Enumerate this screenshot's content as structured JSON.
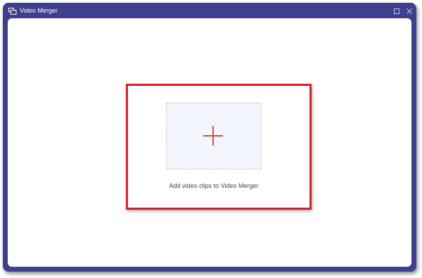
{
  "window": {
    "title": "Video Merger",
    "app_icon": "merge-windows-icon",
    "controls": [
      "maximize-icon",
      "close-icon"
    ]
  },
  "main": {
    "add_prompt": "Add video clips to Video Merger",
    "drop_zone_icon": "plus-icon"
  },
  "colors": {
    "frame": "#3f3f8f",
    "highlight": "#d2232a",
    "plus": "#e0493a",
    "drop_zone_bg": "#f2f5fb"
  }
}
